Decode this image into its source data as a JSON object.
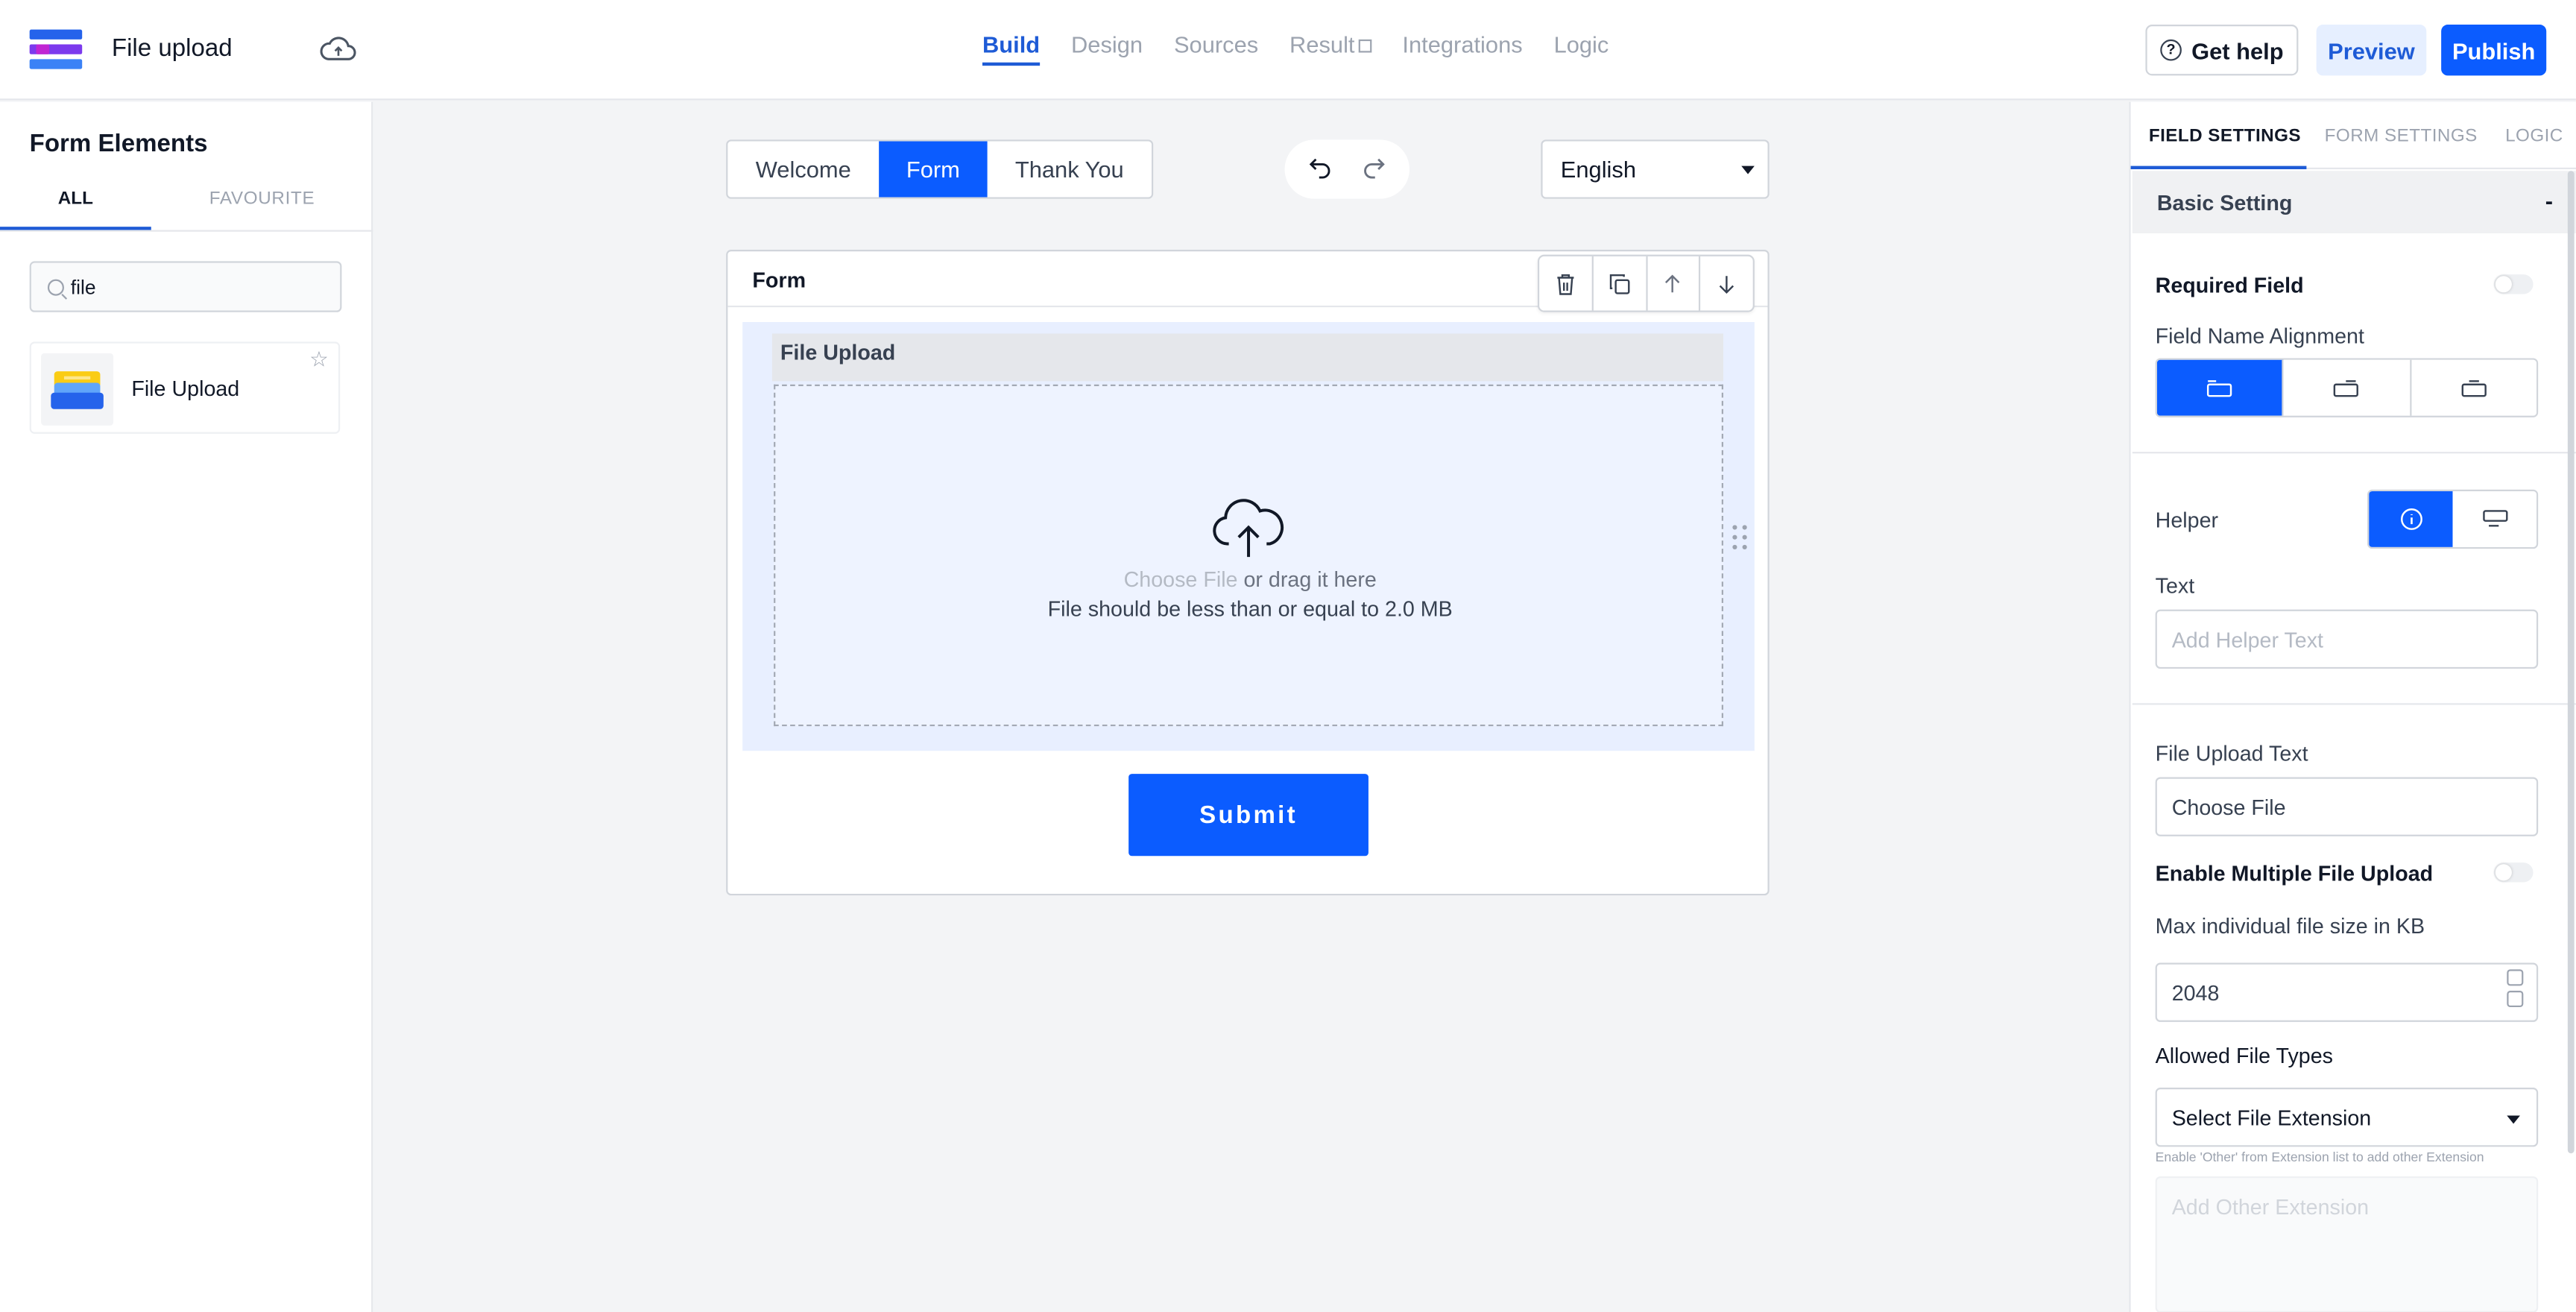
{
  "header": {
    "app_title": "File upload",
    "nav": [
      {
        "label": "Build",
        "active": true
      },
      {
        "label": "Design",
        "active": false
      },
      {
        "label": "Sources",
        "active": false
      },
      {
        "label": "Result",
        "active": false,
        "external": true
      },
      {
        "label": "Integrations",
        "active": false
      },
      {
        "label": "Logic",
        "active": false
      }
    ],
    "help_label": "Get help",
    "preview_label": "Preview",
    "publish_label": "Publish",
    "icons": {
      "logo": "app-logo",
      "cloud": "cloud-save-icon",
      "help": "help-circle-icon",
      "result_external": "external-link-icon"
    }
  },
  "left_panel": {
    "title": "Form Elements",
    "tabs": [
      "ALL",
      "FAVOURITE"
    ],
    "active_tab": "ALL",
    "search_value": "file",
    "elements": [
      {
        "label": "File Upload",
        "icon": "file-upload-element-icon",
        "favourite": false
      }
    ]
  },
  "canvas": {
    "pages": [
      "Welcome",
      "Form",
      "Thank You"
    ],
    "active_page": "Form",
    "language": "English",
    "form_title": "Form",
    "field": {
      "label": "File Upload",
      "choose_file": "Choose File",
      "drag_text": " or drag it here",
      "limit_text": "File should be less than or equal to 2.0 MB"
    },
    "submit_label": "Submit"
  },
  "right_panel": {
    "tabs": [
      "FIELD SETTINGS",
      "FORM SETTINGS",
      "LOGIC"
    ],
    "active_tab": "FIELD SETTINGS",
    "section_title": "Basic Setting",
    "section_toggle": "-",
    "required_field_label": "Required Field",
    "required_field_on": false,
    "alignment_label": "Field Name Alignment",
    "alignment_selected": 0,
    "helper_label": "Helper",
    "helper_selected": 0,
    "text_label": "Text",
    "helper_text_placeholder": "Add Helper Text",
    "upload_text_label": "File Upload Text",
    "upload_text_value": "Choose File",
    "multi_upload_label": "Enable Multiple File Upload",
    "multi_upload_on": false,
    "max_size_label": "Max individual file size in KB",
    "max_size_value": "2048",
    "file_types_label": "Allowed File Types",
    "file_types_select": "Select File Extension",
    "file_types_hint": "Enable 'Other' from Extension list to add other Extension",
    "other_ext_placeholder": "Add Other Extension"
  },
  "colors": {
    "primary": "#0b5cff",
    "nav_active": "#1e5bd6",
    "canvas_bg": "#f3f4f6",
    "field_bg": "#e8efff"
  }
}
